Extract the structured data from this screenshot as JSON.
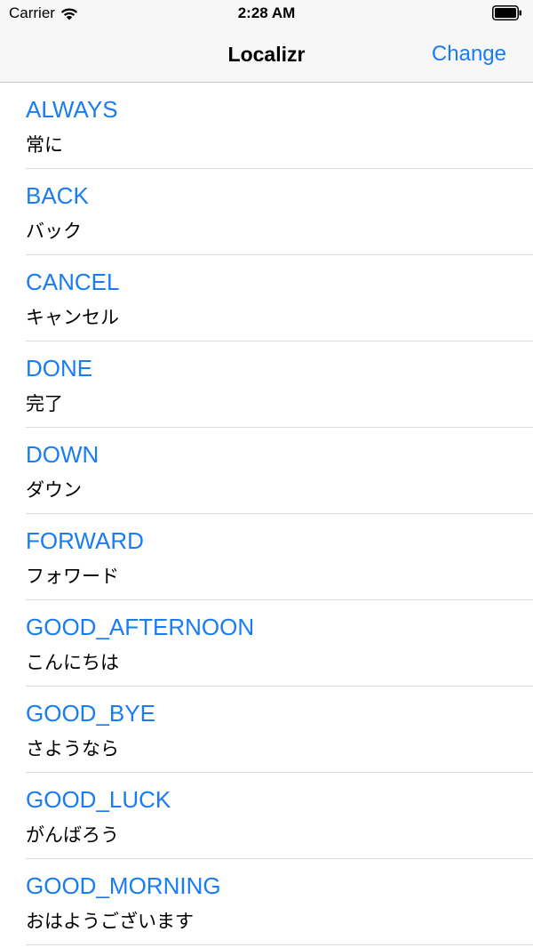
{
  "status_bar": {
    "carrier": "Carrier",
    "time": "2:28 AM"
  },
  "nav": {
    "title": "Localizr",
    "action_label": "Change"
  },
  "colors": {
    "accent": "#1a7cf3",
    "bar_background": "#f7f7f7",
    "separator": "#dcdcdf"
  },
  "items": [
    {
      "key": "ALWAYS",
      "value": "常に"
    },
    {
      "key": "BACK",
      "value": "バック"
    },
    {
      "key": "CANCEL",
      "value": "キャンセル"
    },
    {
      "key": "DONE",
      "value": "完了"
    },
    {
      "key": "DOWN",
      "value": "ダウン"
    },
    {
      "key": "FORWARD",
      "value": "フォワード"
    },
    {
      "key": "GOOD_AFTERNOON",
      "value": "こんにちは"
    },
    {
      "key": "GOOD_BYE",
      "value": "さようなら"
    },
    {
      "key": "GOOD_LUCK",
      "value": "がんばろう"
    },
    {
      "key": "GOOD_MORNING",
      "value": "おはようございます"
    }
  ]
}
